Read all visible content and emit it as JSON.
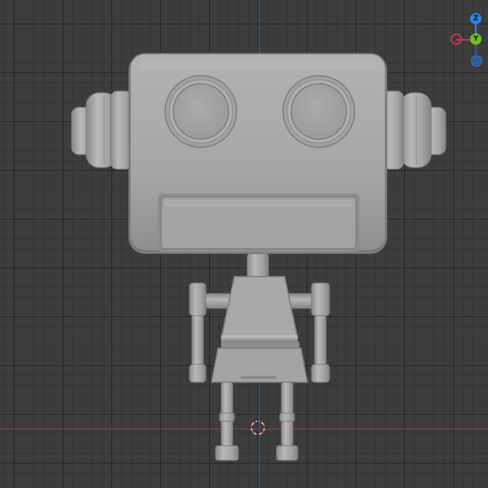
{
  "viewport": {
    "background_color": "#3d3d3d",
    "x_axis_color": "#9a3b46",
    "y_axis_color": "#3b67a8"
  },
  "gizmo": {
    "z_label": "Z",
    "y_label": "Y",
    "z_color": "#2e82e6",
    "y_color": "#6fbf22",
    "x_color": "#c4384a"
  },
  "scene": {
    "object": "robot",
    "material_color": "#a6a6a6"
  }
}
